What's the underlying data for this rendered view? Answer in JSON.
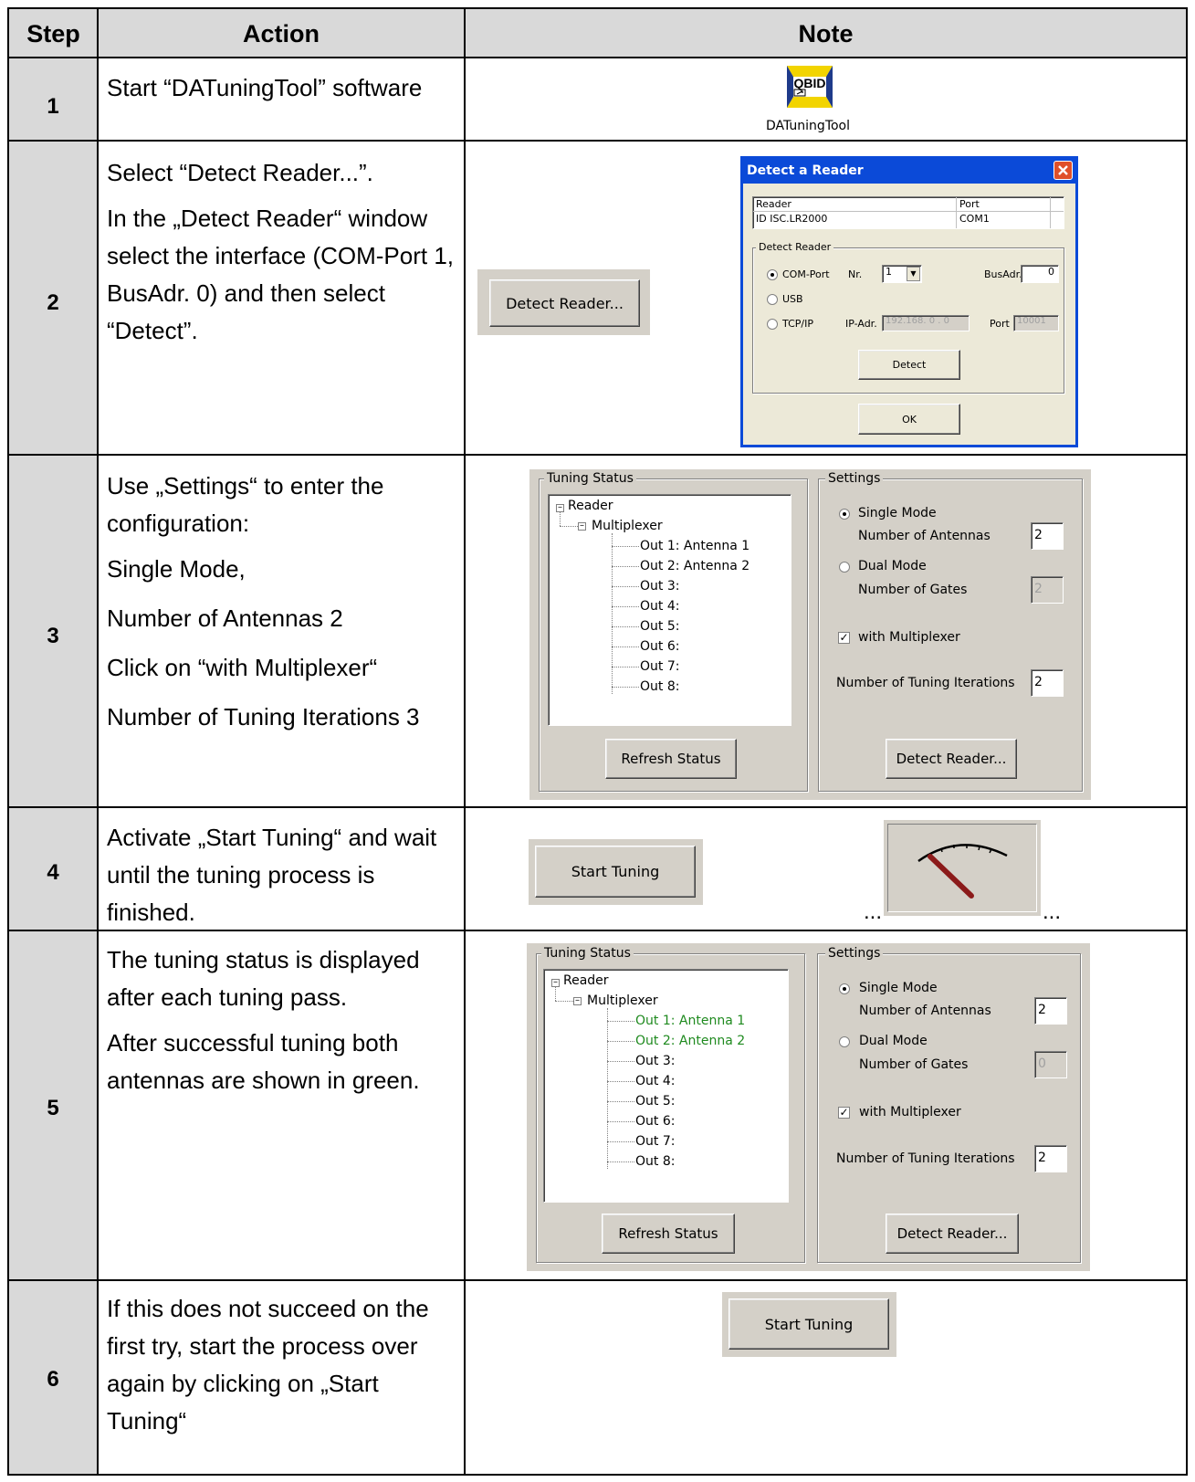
{
  "header": {
    "step": "Step",
    "action": "Action",
    "note": "Note"
  },
  "steps": [
    {
      "num": "1",
      "action": [
        "Start “DATuningTool” software"
      ]
    },
    {
      "num": "2",
      "action": [
        " Select “Detect Reader...”.",
        "In the „Detect Reader“ window select the interface (COM-Port 1, BusAdr. 0) and then select “Detect”."
      ]
    },
    {
      "num": "3",
      "action": [
        "Use „Settings“ to enter the configuration:",
        "Single Mode,",
        "Number of Antennas 2",
        "Click on “with Multiplexer“",
        "Number of Tuning Iterations 3"
      ]
    },
    {
      "num": "4",
      "action": [
        "Activate „Start Tuning“ and wait until the tuning process is finished."
      ]
    },
    {
      "num": "5",
      "action": [
        "The tuning status is displayed after each tuning pass.",
        "After successful tuning both antennas are shown in green."
      ]
    },
    {
      "num": "6",
      "action": [
        "If this does not succeed on the first try, start the process over again by clicking on „Start Tuning“"
      ]
    }
  ],
  "step1": {
    "icon_text": "QBID",
    "icon_label": "DATuningTool"
  },
  "step2": {
    "detect_button": "Detect Reader...",
    "dialog": {
      "title": "Detect a Reader",
      "col_reader": "Reader",
      "col_port": "Port",
      "row_reader": "ID ISC.LR2000",
      "row_port": "COM1",
      "group": "Detect Reader",
      "com_port": "COM-Port",
      "nr_label": "Nr.",
      "nr_value": "1",
      "busadr_label": "BusAdr.",
      "busadr_value": "0",
      "usb": "USB",
      "tcpip": "TCP/IP",
      "ipadr_label": "IP-Adr.",
      "ipadr_value": "192.168. 0 . 0",
      "port_label": "Port",
      "port_value": "10001",
      "detect": "Detect",
      "ok": "OK"
    }
  },
  "panel3": {
    "tuning_status": "Tuning Status",
    "settings": "Settings",
    "tree": {
      "reader": "Reader",
      "mux": "Multiplexer",
      "outs": [
        "Out 1: Antenna 1",
        "Out 2: Antenna 2",
        "Out 3:",
        "Out 4:",
        "Out 5:",
        "Out 6:",
        "Out 7:",
        "Out 8:"
      ]
    },
    "single_mode": "Single Mode",
    "num_antennas": "Number of Antennas",
    "num_antennas_value": "2",
    "dual_mode": "Dual Mode",
    "num_gates": "Number of Gates",
    "num_gates_value": "2",
    "with_mux": "with Multiplexer",
    "iterations": "Number of Tuning Iterations",
    "iterations_value": "2",
    "refresh": "Refresh Status",
    "detect_reader": "Detect Reader..."
  },
  "step4": {
    "start_tuning": "Start Tuning",
    "ellipsis_left": "...",
    "ellipsis_right": "..."
  },
  "panel5": {
    "tuning_status": "Tuning Status",
    "settings": "Settings",
    "tree": {
      "reader": "Reader",
      "mux": "Multiplexer",
      "outs": [
        "Out 1: Antenna 1",
        "Out 2: Antenna 2",
        "Out 3:",
        "Out 4:",
        "Out 5:",
        "Out 6:",
        "Out 7:",
        "Out 8:"
      ]
    },
    "green_color": "#1f8a1f",
    "single_mode": "Single Mode",
    "num_antennas": "Number of Antennas",
    "num_antennas_value": "2",
    "dual_mode": "Dual Mode",
    "num_gates": "Number of Gates",
    "num_gates_value": "0",
    "with_mux": "with Multiplexer",
    "iterations": "Number of Tuning Iterations",
    "iterations_value": "2",
    "refresh": "Refresh Status",
    "detect_reader": "Detect Reader..."
  },
  "step6": {
    "start_tuning": "Start Tuning"
  }
}
